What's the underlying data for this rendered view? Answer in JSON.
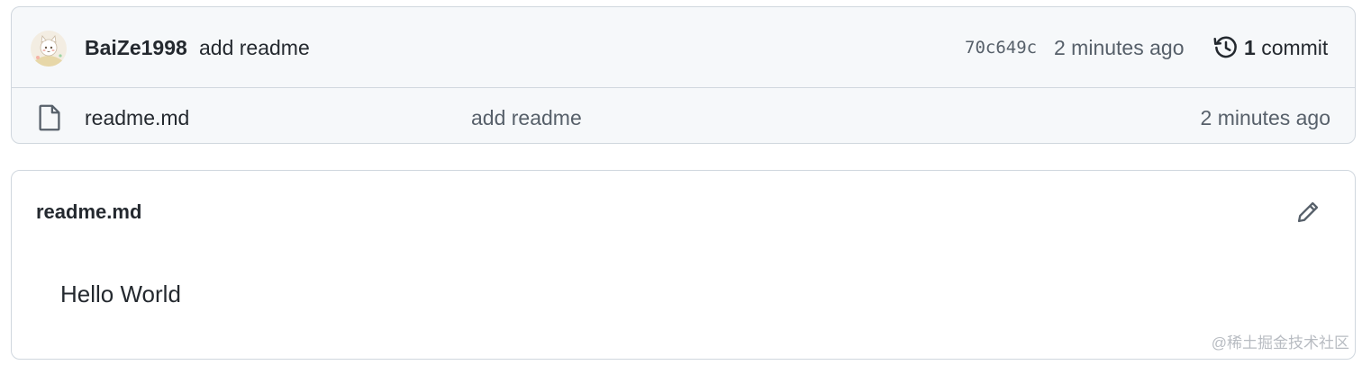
{
  "latest_commit": {
    "author": "BaiZe1998",
    "message": "add readme",
    "sha": "70c649c",
    "time": "2 minutes ago",
    "count": "1",
    "count_label": "commit"
  },
  "files": [
    {
      "icon": "file-icon",
      "name": "readme.md",
      "commit_message": "add readme",
      "time": "2 minutes ago"
    }
  ],
  "readme": {
    "title": "readme.md",
    "content": "Hello World"
  },
  "watermark": "@稀土掘金技术社区",
  "colors": {
    "border": "#d0d7de",
    "header_bg": "#f6f8fa",
    "text": "#24292f",
    "muted": "#57606a"
  }
}
